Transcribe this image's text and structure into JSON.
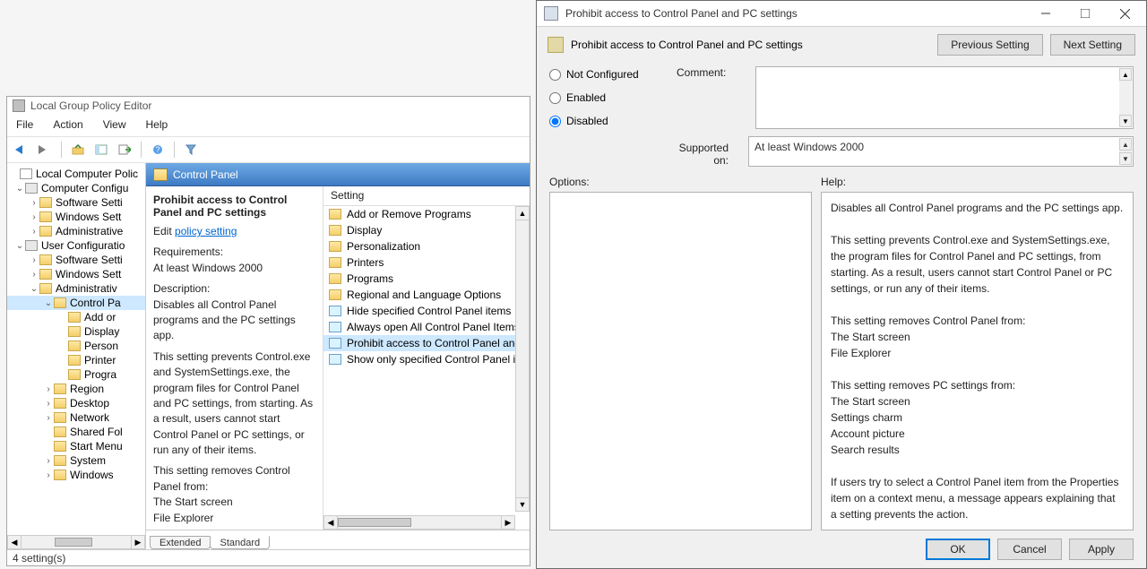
{
  "gpe": {
    "title": "Local Group Policy Editor",
    "menus": {
      "file": "File",
      "action": "Action",
      "view": "View",
      "help": "Help"
    },
    "tree": {
      "root": "Local Computer Polic",
      "cc": "Computer Configu",
      "cc_soft": "Software Setti",
      "cc_win": "Windows Sett",
      "cc_admin": "Administrative",
      "uc": "User Configuratio",
      "uc_soft": "Software Setti",
      "uc_win": "Windows Sett",
      "uc_admin": "Administrativ",
      "cp": "Control Pa",
      "cp_add": "Add or",
      "cp_display": "Display",
      "cp_person": "Person",
      "cp_printer": "Printer",
      "cp_progra": "Progra",
      "cp_region": "Region",
      "desktop": "Desktop",
      "network": "Network",
      "shared": "Shared Fol",
      "start": "Start Menu",
      "system": "System",
      "windows": "Windows"
    },
    "mid": {
      "header": "Control Panel",
      "title": "Prohibit access to Control Panel and PC settings",
      "edit_prefix": "Edit",
      "edit_link": "policy setting",
      "req_label": "Requirements:",
      "req_value": "At least Windows 2000",
      "desc_label": "Description:",
      "desc1": "Disables all Control Panel programs and the PC settings app.",
      "desc2": "This setting prevents Control.exe and SystemSettings.exe, the program files for Control Panel and PC settings, from starting. As a result, users cannot start Control Panel or PC settings, or run any of their items.",
      "desc3": "This setting removes Control Panel from:",
      "desc3a": "The Start screen",
      "desc3b": "File Explorer",
      "list_header": "Setting",
      "items": [
        {
          "type": "folder",
          "label": "Add or Remove Programs"
        },
        {
          "type": "folder",
          "label": "Display"
        },
        {
          "type": "folder",
          "label": "Personalization"
        },
        {
          "type": "folder",
          "label": "Printers"
        },
        {
          "type": "folder",
          "label": "Programs"
        },
        {
          "type": "folder",
          "label": "Regional and Language Options"
        },
        {
          "type": "policy",
          "label": "Hide specified Control Panel items"
        },
        {
          "type": "policy",
          "label": "Always open All Control Panel Items"
        },
        {
          "type": "policy",
          "label": "Prohibit access to Control Panel and"
        },
        {
          "type": "policy",
          "label": "Show only specified Control Panel it"
        }
      ],
      "selected_index": 8,
      "tab_extended": "Extended",
      "tab_standard": "Standard"
    },
    "status": "4 setting(s)"
  },
  "dlg": {
    "title": "Prohibit access to Control Panel and PC settings",
    "header": "Prohibit access to Control Panel and PC settings",
    "prev_btn": "Previous Setting",
    "next_btn": "Next Setting",
    "radio_nc": "Not Configured",
    "radio_en": "Enabled",
    "radio_dis": "Disabled",
    "comment_label": "Comment:",
    "supported_label": "Supported on:",
    "supported_value": "At least Windows 2000",
    "options_label": "Options:",
    "help_label": "Help:",
    "help_p1": "Disables all Control Panel programs and the PC settings app.",
    "help_p2": "This setting prevents Control.exe and SystemSettings.exe, the program files for Control Panel and PC settings, from starting. As a result, users cannot start Control Panel or PC settings, or run any of their items.",
    "help_p3": "This setting removes Control Panel from:",
    "help_p3a": "The Start screen",
    "help_p3b": "File Explorer",
    "help_p4": "This setting removes PC settings from:",
    "help_p4a": "The Start screen",
    "help_p4b": "Settings charm",
    "help_p4c": "Account picture",
    "help_p4d": "Search results",
    "help_p5": "If users try to select a Control Panel item from the Properties item on a context menu, a message appears explaining that a setting prevents the action.",
    "ok": "OK",
    "cancel": "Cancel",
    "apply": "Apply"
  }
}
